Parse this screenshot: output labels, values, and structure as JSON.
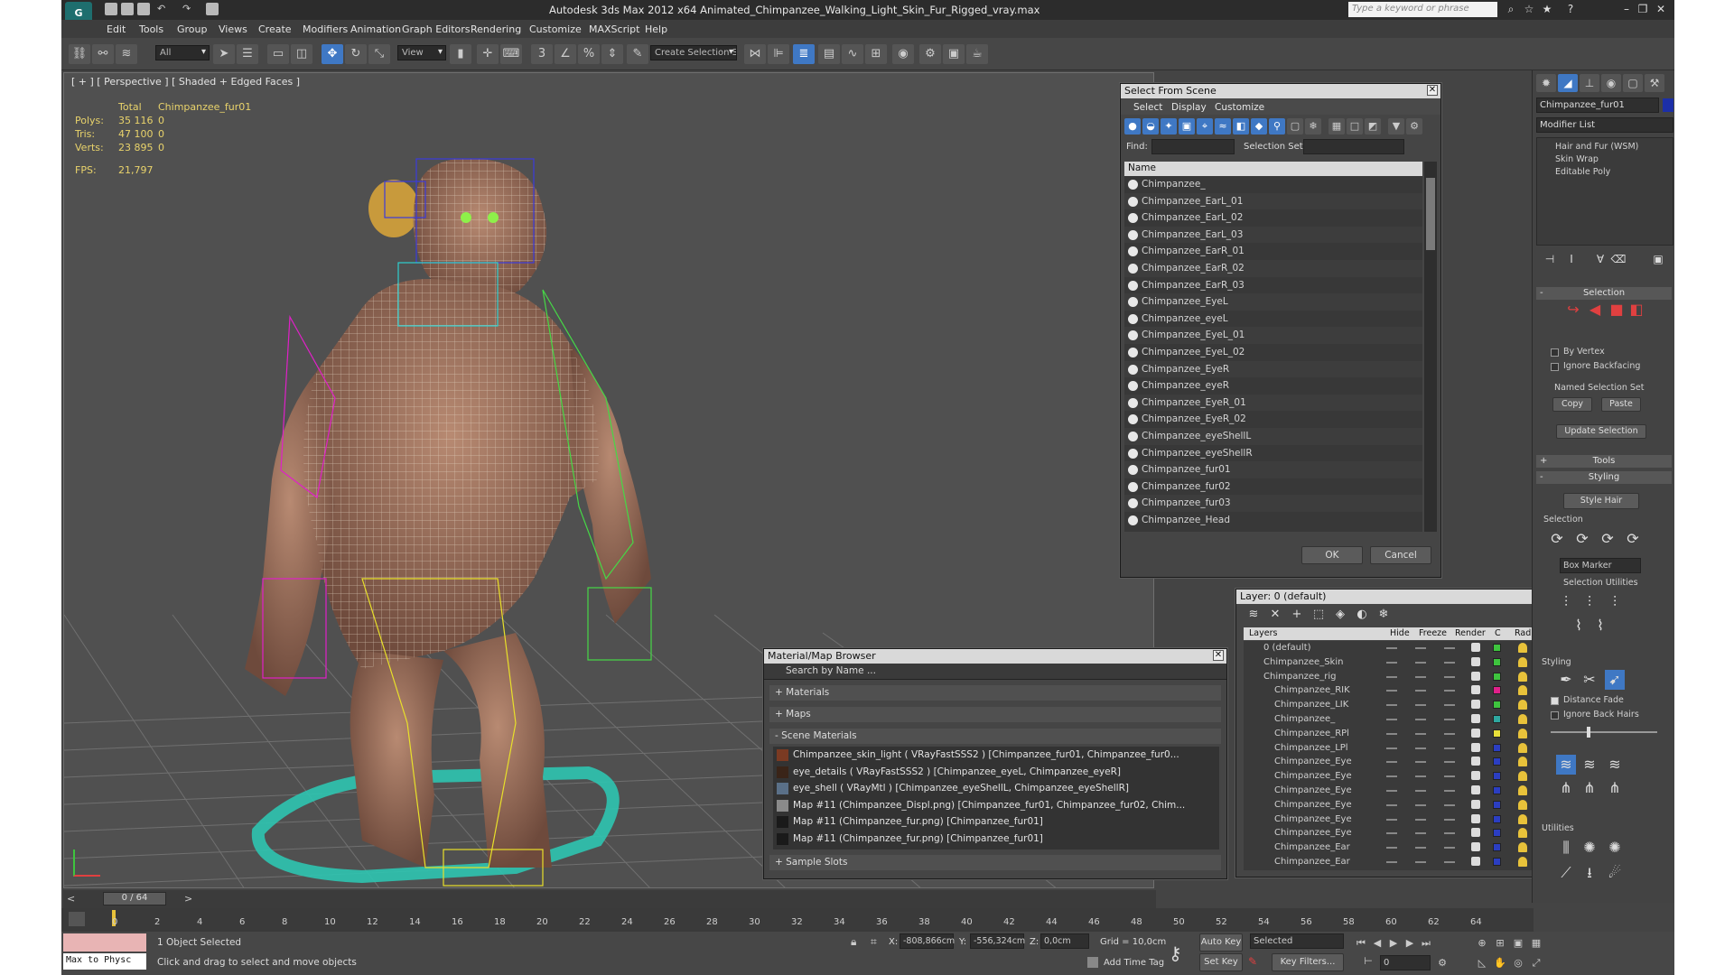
{
  "app": {
    "title": "Autodesk 3ds Max  2012 x64     Animated_Chimpanzee_Walking_Light_Skin_Fur_Rigged_vray.max",
    "search_placeholder": "Type a keyword or phrase"
  },
  "menu": [
    "Edit",
    "Tools",
    "Group",
    "Views",
    "Create",
    "Modifiers",
    "Animation",
    "Graph Editors",
    "Rendering",
    "Customize",
    "MAXScript",
    "Help"
  ],
  "toolbar": {
    "filter": "All",
    "ref_coord": "View",
    "named_selection": "Create Selection Se"
  },
  "viewport": {
    "label": "[ + ] [ Perspective ] [ Shaded + Edged Faces ]",
    "stats": {
      "col_total": "Total",
      "col_object": "Chimpanzee_fur01",
      "rows": [
        {
          "label": "Polys:",
          "total": "35 116",
          "obj": "0"
        },
        {
          "label": "Tris:",
          "total": "47 100",
          "obj": "0"
        },
        {
          "label": "Verts:",
          "total": "23 895",
          "obj": "0"
        }
      ],
      "fps_label": "FPS:",
      "fps": "21,797"
    }
  },
  "select_from_scene": {
    "title": "Select From Scene",
    "menu": [
      "Select",
      "Display",
      "Customize"
    ],
    "find_label": "Find:",
    "selection_set_label": "Selection Set:",
    "column": "Name",
    "items": [
      "Chimpanzee_",
      "Chimpanzee_EarL_01",
      "Chimpanzee_EarL_02",
      "Chimpanzee_EarL_03",
      "Chimpanzee_EarR_01",
      "Chimpanzee_EarR_02",
      "Chimpanzee_EarR_03",
      "Chimpanzee_EyeL",
      "Chimpanzee_eyeL",
      "Chimpanzee_EyeL_01",
      "Chimpanzee_EyeL_02",
      "Chimpanzee_EyeR",
      "Chimpanzee_eyeR",
      "Chimpanzee_EyeR_01",
      "Chimpanzee_EyeR_02",
      "Chimpanzee_eyeShellL",
      "Chimpanzee_eyeShellR",
      "Chimpanzee_fur01",
      "Chimpanzee_fur02",
      "Chimpanzee_fur03",
      "Chimpanzee_Head"
    ],
    "ok": "OK",
    "cancel": "Cancel"
  },
  "material_browser": {
    "title": "Material/Map Browser",
    "search": "Search by Name ...",
    "sections": [
      "+ Materials",
      "+ Maps",
      "- Scene Materials",
      "+ Sample Slots"
    ],
    "materials": [
      {
        "text": "Chimpanzee_skin_light  ( VRayFastSSS2 )  [Chimpanzee_fur01, Chimpanzee_fur0...",
        "color": "#7a3a22"
      },
      {
        "text": "eye_details  ( VRayFastSSS2 )  [Chimpanzee_eyeL, Chimpanzee_eyeR]",
        "color": "#3a2418"
      },
      {
        "text": "eye_shell  ( VRayMtl )  [Chimpanzee_eyeShellL, Chimpanzee_eyeShellR]",
        "color": "#5a7088"
      },
      {
        "text": "Map #11 (Chimpanzee_Displ.png)  [Chimpanzee_fur01, Chimpanzee_fur02, Chim...",
        "color": "#8a8a8a"
      },
      {
        "text": "Map #11 (Chimpanzee_fur.png)  [Chimpanzee_fur01]",
        "color": "#1a1a1a"
      },
      {
        "text": "Map #11 (Chimpanzee_fur.png)  [Chimpanzee_fur01]",
        "color": "#1a1a1a"
      }
    ]
  },
  "layer_manager": {
    "title": "Layer: 0 (default)",
    "columns": [
      "Layers",
      "Hide",
      "Freeze",
      "Render",
      "C",
      "Radiosity"
    ],
    "rows": [
      {
        "name": "0 (default)",
        "indent": 0,
        "color": "#3ec43e"
      },
      {
        "name": "Chimpanzee_Skin",
        "indent": 0,
        "color": "#3ec43e"
      },
      {
        "name": "Chimpanzee_rig",
        "indent": 0,
        "color": "#3ec43e"
      },
      {
        "name": "Chimpanzee_RIK",
        "indent": 1,
        "color": "#e0208a"
      },
      {
        "name": "Chimpanzee_LIK",
        "indent": 1,
        "color": "#3ec43e"
      },
      {
        "name": "Chimpanzee_",
        "indent": 1,
        "color": "#2ea8a0"
      },
      {
        "name": "Chimpanzee_RPl",
        "indent": 1,
        "color": "#e8e03a"
      },
      {
        "name": "Chimpanzee_LPl",
        "indent": 1,
        "color": "#2b3ec2"
      },
      {
        "name": "Chimpanzee_Eye",
        "indent": 1,
        "color": "#2b3ec2"
      },
      {
        "name": "Chimpanzee_Eye",
        "indent": 1,
        "color": "#2b3ec2"
      },
      {
        "name": "Chimpanzee_Eye",
        "indent": 1,
        "color": "#2b3ec2"
      },
      {
        "name": "Chimpanzee_Eye",
        "indent": 1,
        "color": "#2b3ec2"
      },
      {
        "name": "Chimpanzee_Eye",
        "indent": 1,
        "color": "#2b3ec2"
      },
      {
        "name": "Chimpanzee_Eye",
        "indent": 1,
        "color": "#2b3ec2"
      },
      {
        "name": "Chimpanzee_Ear",
        "indent": 1,
        "color": "#2b3ec2"
      },
      {
        "name": "Chimpanzee_Ear",
        "indent": 1,
        "color": "#2b3ec2"
      }
    ]
  },
  "command_panel": {
    "object_name": "Chimpanzee_fur01",
    "modifier_list": "Modifier List",
    "stack": [
      "Hair and Fur (WSM)",
      "Skin Wrap",
      "Editable Poly"
    ],
    "selection_header": "Selection",
    "by_vertex": "By Vertex",
    "ignore_backfacing": "Ignore Backfacing",
    "named_selection_set": "Named Selection Set",
    "copy": "Copy",
    "paste": "Paste",
    "update_selection": "Update Selection",
    "tools_header": "Tools",
    "styling_header": "Styling",
    "style_hair": "Style Hair",
    "selection_group": "Selection",
    "box_marker": "Box Marker",
    "selection_utilities": "Selection Utilities",
    "styling_group": "Styling",
    "distance_fade": "Distance Fade",
    "ignore_back_hairs": "Ignore Back Hairs",
    "utilities_group": "Utilities"
  },
  "timeline": {
    "frame": "0 / 64",
    "ticks": [
      "0",
      "2",
      "4",
      "6",
      "8",
      "10",
      "12",
      "14",
      "16",
      "18",
      "20",
      "22",
      "24",
      "26",
      "28",
      "30",
      "32",
      "34",
      "36",
      "38",
      "40",
      "42",
      "44",
      "46",
      "48",
      "50",
      "52",
      "54",
      "56",
      "58",
      "60",
      "62",
      "64"
    ]
  },
  "status": {
    "script_listener": "Max to Physc",
    "selection_info": "1 Object Selected",
    "prompt": "Click and drag to select and move objects",
    "x_label": "X:",
    "x": "-808,866cm",
    "y_label": "Y:",
    "y": "-556,324cm",
    "z_label": "Z:",
    "z": "0,0cm",
    "grid": "Grid = 10,0cm",
    "add_time_tag": "Add Time Tag",
    "auto_key": "Auto Key",
    "set_key": "Set Key",
    "key_mode": "Selected",
    "key_filters": "Key Filters...",
    "frame_field": "0"
  }
}
